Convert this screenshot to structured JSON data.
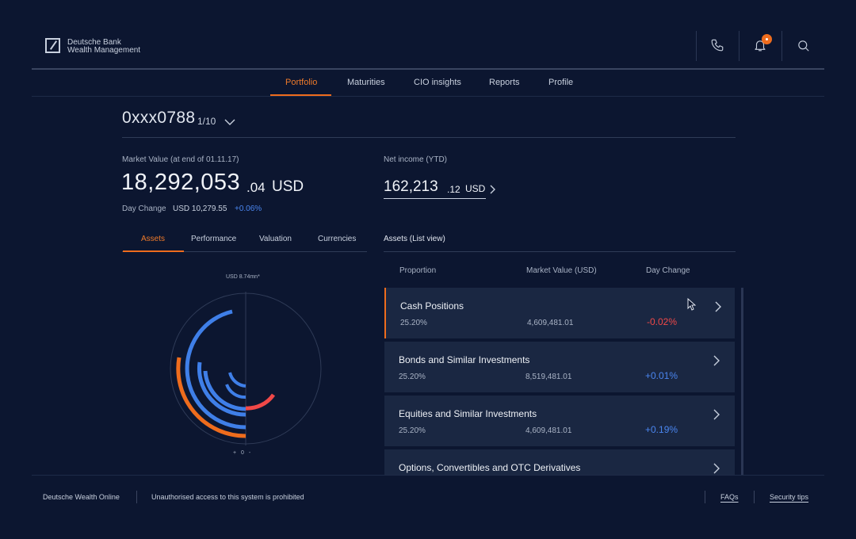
{
  "brand": {
    "line1": "Deutsche Bank",
    "line2": "Wealth Management"
  },
  "header": {
    "icons": [
      "phone-icon",
      "bell-icon",
      "search-icon"
    ],
    "accent": "#ee6c1d"
  },
  "nav": {
    "items": [
      "Portfolio",
      "Maturities",
      "CIO insights",
      "Reports",
      "Profile"
    ],
    "active": "Portfolio"
  },
  "account": {
    "id": "0xxx0788",
    "page": "1/10"
  },
  "market_value": {
    "label": "Market Value (at end of 01.11.17)",
    "integer": "18,292,053",
    "decimal": ".04",
    "currency": "USD",
    "day_change_label": "Day Change",
    "day_change_value": "USD 10,279.55",
    "day_change_pct": "+0.06%"
  },
  "net_income": {
    "label": "Net income (YTD)",
    "integer": "162,213",
    "decimal": ".12",
    "currency": "USD"
  },
  "tabs": [
    "Assets",
    "Performance",
    "Valuation",
    "Currencies"
  ],
  "active_tab": "Assets",
  "chart": {
    "top_label": "USD 8.74mn*",
    "zoom": "+ 0 -"
  },
  "list": {
    "title": "Assets (List view)",
    "headers": [
      "Proportion",
      "Market Value (USD)",
      "Day Change"
    ],
    "rows": [
      {
        "name": "Cash Positions",
        "proportion": "25.20%",
        "market_value": "4,609,481.01",
        "day_change": "-0.02%"
      },
      {
        "name": "Bonds and Similar Investments",
        "proportion": "25.20%",
        "market_value": "8,519,481.01",
        "day_change": "+0.01%"
      },
      {
        "name": "Equities and Similar Investments",
        "proportion": "25.20%",
        "market_value": "4,609,481.01",
        "day_change": "+0.19%"
      },
      {
        "name": "Options, Convertibles and OTC Derivatives"
      }
    ]
  },
  "footer": {
    "app": "Deutsche Wealth Online",
    "notice": "Unauthorised access to this system is prohibited",
    "links": [
      "FAQs",
      "Security tips"
    ]
  }
}
